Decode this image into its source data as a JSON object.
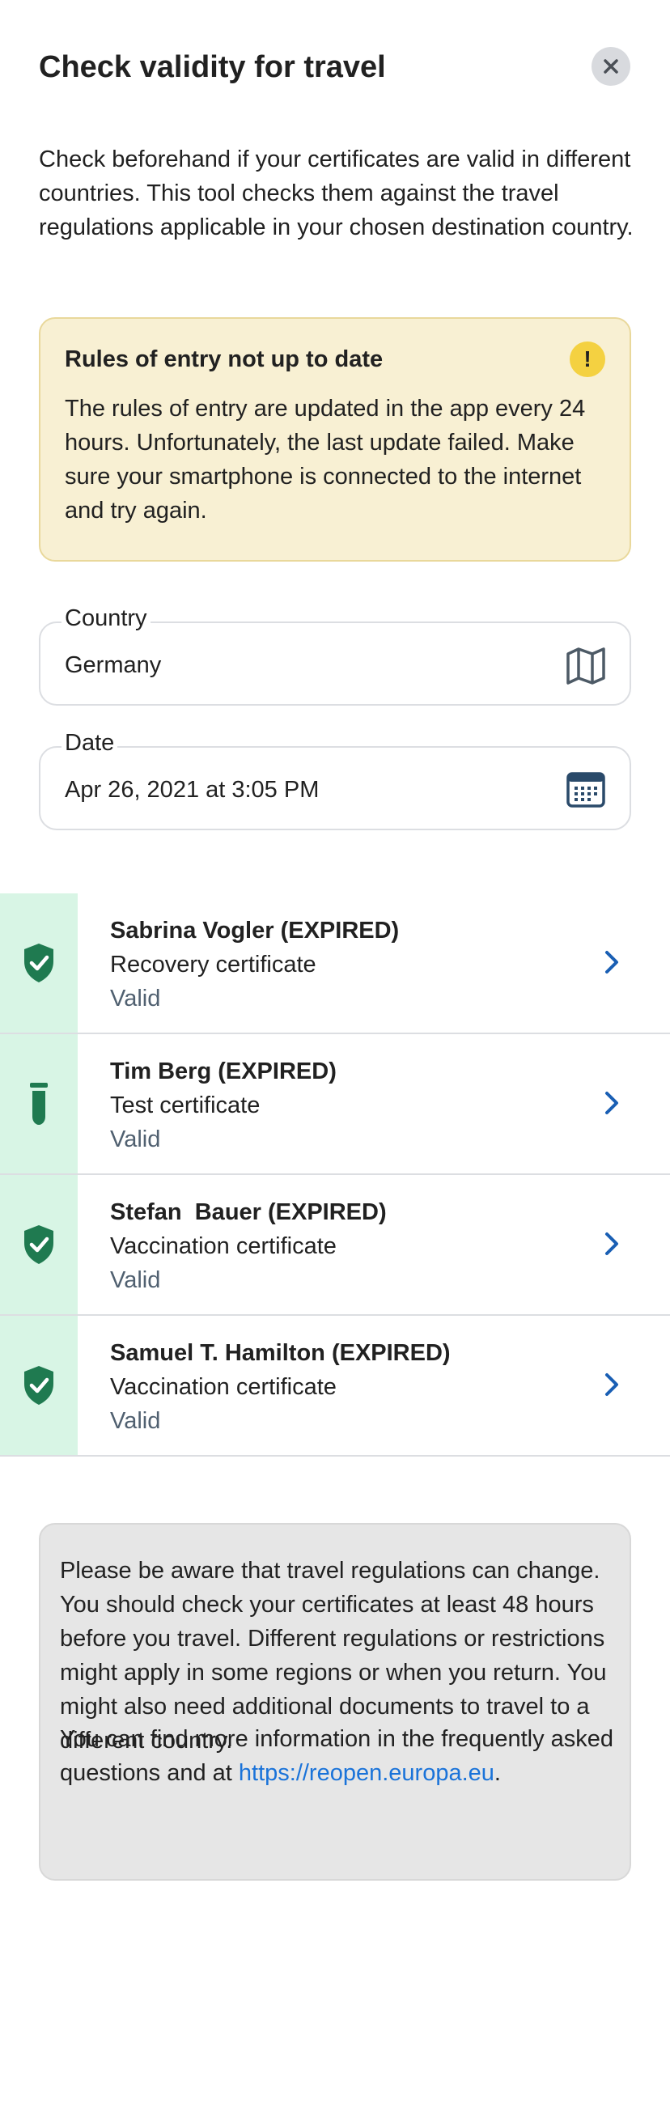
{
  "header": {
    "title": "Check validity for travel"
  },
  "intro": "Check beforehand if your certificates are valid in different countries. This tool checks them against the travel regulations applicable in your chosen destination country.",
  "warning": {
    "title": "Rules of entry not up to date",
    "icon": "exclamation-icon",
    "text": "The rules of entry are updated in the app every 24 hours. Unfortunately, the last update failed. Make sure your smartphone is connected to the internet and try again."
  },
  "country_field": {
    "label": "Country",
    "value": "Germany",
    "icon": "map-icon"
  },
  "date_field": {
    "label": "Date",
    "value": "Apr 26, 2021 at 3:05 PM",
    "icon": "calendar-icon"
  },
  "certificates": [
    {
      "name": "Sabrina Vogler (EXPIRED)",
      "type": "Recovery certificate",
      "status": "Valid",
      "icon": "shield-check-icon"
    },
    {
      "name": "Tim Berg (EXPIRED)",
      "type": "Test certificate",
      "status": "Valid",
      "icon": "test-tube-icon"
    },
    {
      "name": "Stefan  Bauer (EXPIRED)",
      "type": "Vaccination certificate",
      "status": "Valid",
      "icon": "shield-check-icon"
    },
    {
      "name": "Samuel T. Hamilton (EXPIRED)",
      "type": "Vaccination certificate",
      "status": "Valid",
      "icon": "shield-check-icon"
    }
  ],
  "info": {
    "text1": "Please be aware that travel regulations can change. You should check your certificates at least 48 hours before you travel. Different regulations or restrictions might apply in some regions or when you return. You might also need additional documents to travel to a different country.",
    "text2_prefix": "You can find more information in the frequently asked questions and at ",
    "link": "https://reopen.europa.eu",
    "text2_suffix": "."
  },
  "colors": {
    "accent_green": "#1f7a50",
    "link_blue": "#1a73d9",
    "warning_bg": "#f8f0d3",
    "warning_icon": "#f4d141",
    "status_strip": "#d8f5e5"
  }
}
